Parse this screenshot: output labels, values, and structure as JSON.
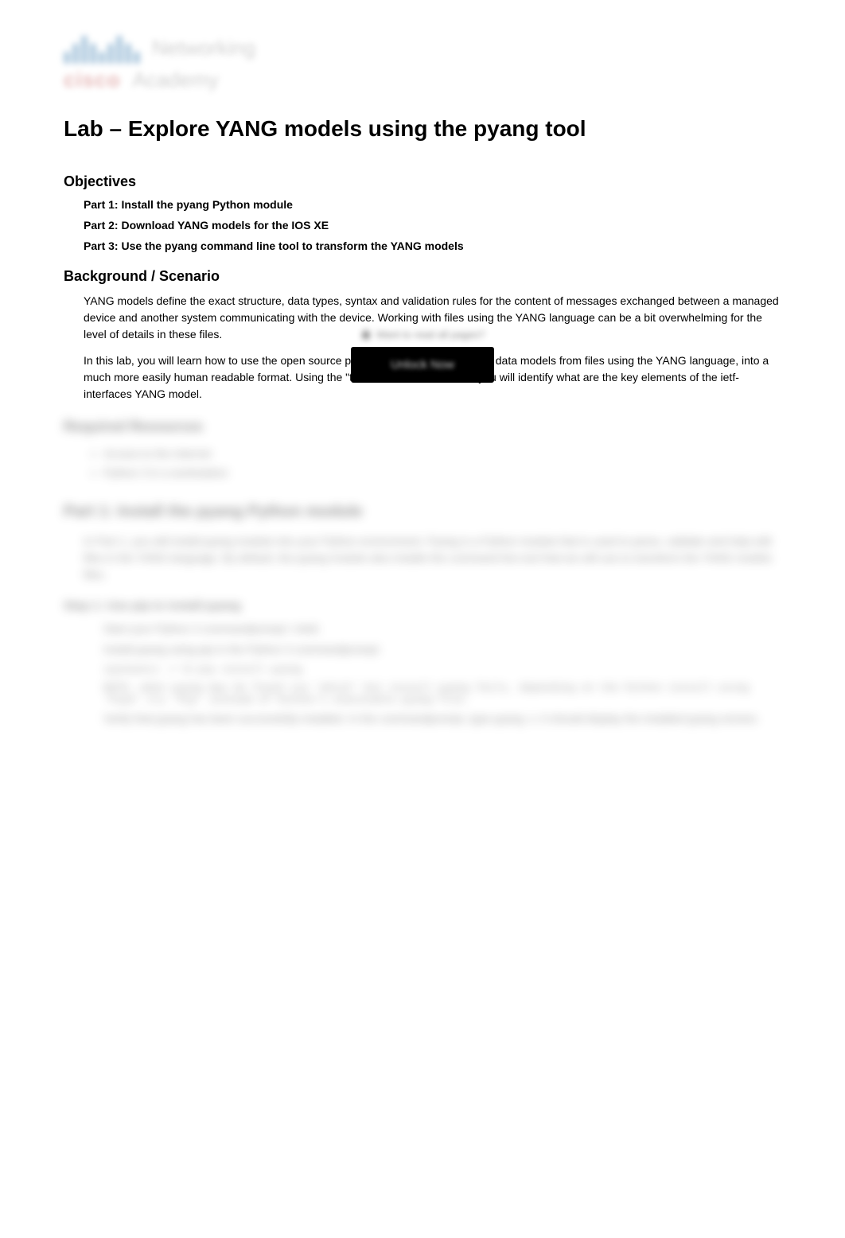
{
  "logo": {
    "brand": "cisco",
    "line1": "Networking",
    "line2": "Academy"
  },
  "title": "Lab – Explore YANG models using the pyang tool",
  "sections": {
    "objectives": {
      "heading": "Objectives",
      "items": [
        "Part 1: Install the pyang Python module",
        "Part 2: Download YANG models for the IOS XE",
        "Part 3: Use the pyang command line tool to transform the YANG models"
      ]
    },
    "background": {
      "heading": "Background / Scenario",
      "paragraphs": [
        "YANG models define the exact structure, data types, syntax and validation rules for the content of messages exchanged between a managed device and another system communicating with the device. Working with files using the YANG language can be a bit overwhelming for the level of details in these files.",
        "In this lab, you will learn how to use the open source pyang tool to transform YANG data models from files using the YANG language, into a much more easily human readable format. Using the \"tree\" view transformation, you will identify what are the key elements of the ietf-interfaces YANG model."
      ]
    }
  },
  "blurred": {
    "required_heading": "Required Resources",
    "required_items": [
      "Access to the Internet",
      "Python 3 in a workstation"
    ],
    "part1_heading": "Part 1: Install the pyang Python module",
    "part1_para": "In Part 1, you will install pyang module into your Python environment. Pyang is a Python module that is used to parse, validate and help edit files in the YANG language. By default, the pyang module also installs the command line tool that we will use to transform the YANG models files.",
    "step1_heading": "Step 1: Use pip to install pyang",
    "step1_items": [
      "Start your Python 3 commandprompt / shell.",
      "Install pyang using pip in the Python 3 commandprompt:"
    ],
    "code_lines": [
      "(py3venv) ~/ $ pip install pyang",
      "NOTE: when pyang may be found via 'which' but install pyang fails, depending on the Python install using 'Pip3' try 'Pip' instead of Python's executable pyang file."
    ],
    "step1_verify": "Verify that pyang has been successfully installed. In the commandprompt, type pyang -v. It should display the installed pyang version.",
    "lock_text": "Want to read all pages?",
    "unlock_label": "Unlock Now"
  }
}
